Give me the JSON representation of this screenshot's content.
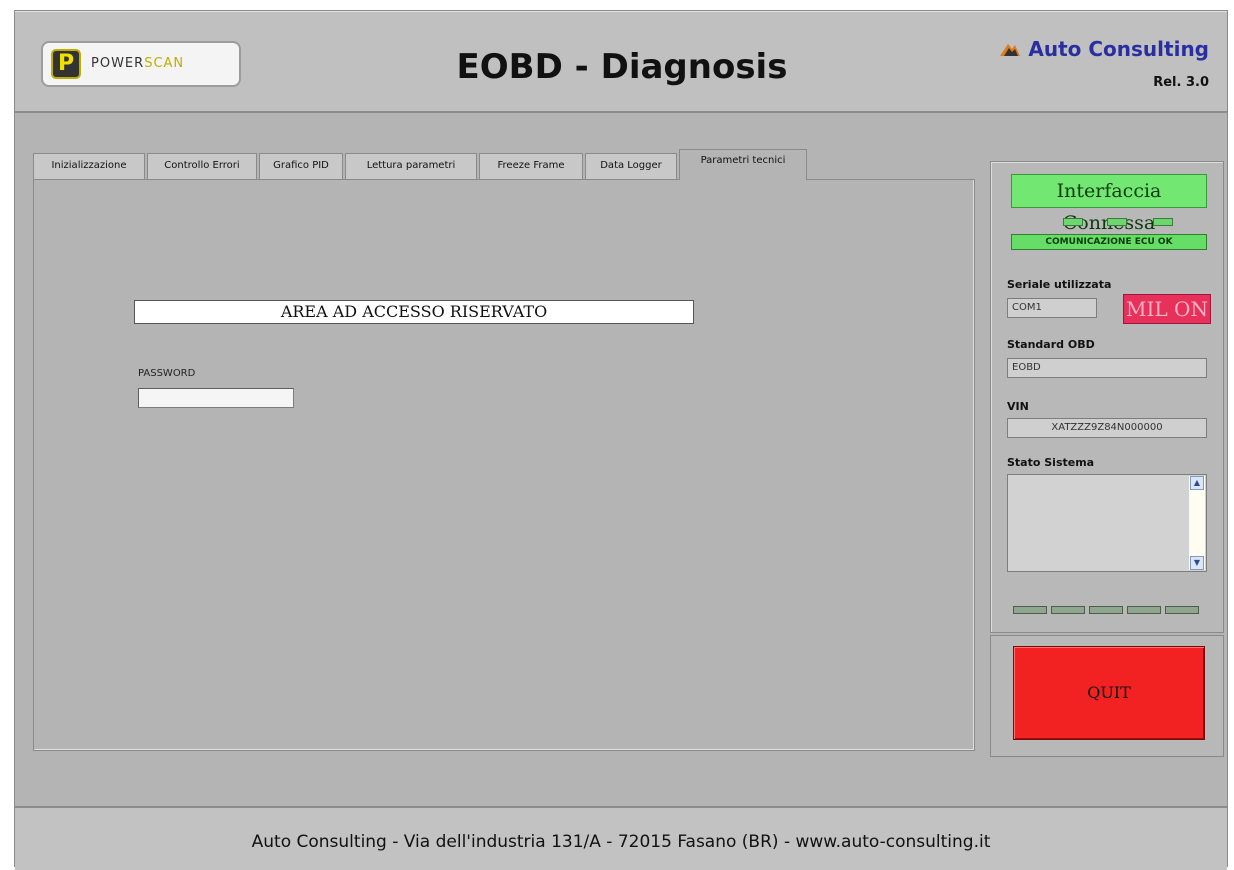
{
  "header": {
    "logo_mark": "P",
    "logo_word_a": "POWER",
    "logo_word_b": "SCAN",
    "title": "EOBD - Diagnosis",
    "brand": "Auto Consulting",
    "release": "Rel. 3.0",
    "brand_icon": "rooftop-logo-icon"
  },
  "tabs": [
    {
      "label": "Inizializzazione",
      "active": false
    },
    {
      "label": "Controllo Errori",
      "active": false
    },
    {
      "label": "Grafico PID",
      "active": false
    },
    {
      "label": "Lettura parametri",
      "active": false
    },
    {
      "label": "Freeze Frame",
      "active": false
    },
    {
      "label": "Data Logger",
      "active": false
    },
    {
      "label": "Parametri tecnici",
      "active": true
    }
  ],
  "main": {
    "restricted_banner": "AREA AD ACCESSO RISERVATO",
    "password_label": "PASSWORD",
    "password_value": ""
  },
  "side": {
    "connection_status": "Interfaccia Connessa",
    "ecu_status": "COMUNICAZIONE ECU OK",
    "serial_label": "Seriale utilizzata",
    "serial_value": "COM1",
    "mil_label": "MIL ON",
    "standard_label": "Standard OBD",
    "standard_value": "EOBD",
    "vin_label": "VIN",
    "vin_value": "XATZZZ9Z84N000000",
    "stato_label": "Stato Sistema",
    "stato_value": ""
  },
  "quit_label": "QUIT",
  "footer": {
    "text": "Auto Consulting - Via dell'industria 131/A - 72015 Fasano (BR) - www.auto-consulting.it"
  },
  "colors": {
    "connected_green": "#72e872",
    "mil_red": "#e8315a",
    "quit_red": "#f22222",
    "brand_blue": "#2a2fa0"
  }
}
